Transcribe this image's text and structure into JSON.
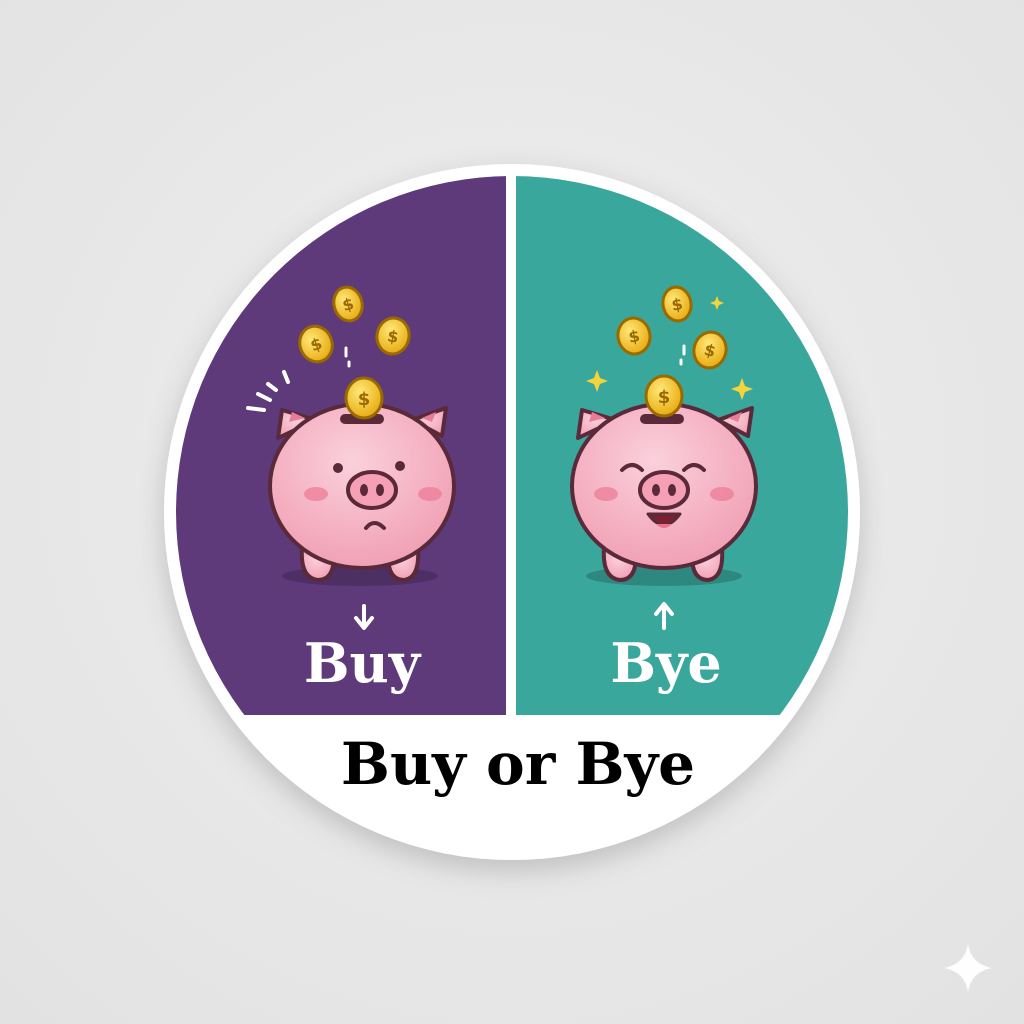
{
  "badge": {
    "left_label": "Buy",
    "right_label": "Bye",
    "title": "Buy or Bye"
  },
  "left_panel": {
    "mood": "sad",
    "arrow": "down-arrow-icon",
    "color": "#5f3a7a"
  },
  "right_panel": {
    "mood": "happy",
    "arrow": "up-arrow-icon",
    "color": "#3aa79d"
  },
  "colors": {
    "background": "#e8e8e8",
    "badge_fill": "#ffffff",
    "pig_pink": "#f4aec0",
    "pig_outline": "#5a2a3a",
    "coin_gold": "#f3c21c",
    "text_dark": "#000000",
    "text_light": "#ffffff"
  }
}
